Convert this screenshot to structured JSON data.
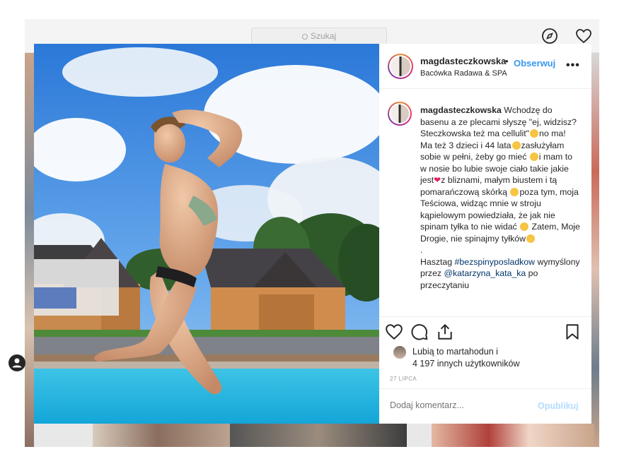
{
  "search": {
    "placeholder": "Szukaj"
  },
  "post": {
    "username": "magdasteczkowska",
    "separator": "•",
    "follow_label": "Obserwuj",
    "location": "Bacówka Radawa & SPA",
    "caption_parts": {
      "p1": "Wchodzę do basenu a ze plecami słyszę \"ej, widzisz? Steczkowska też ma cellulit\"",
      "p2": "no ma! Ma też 3 dzieci i 44 lata",
      "p3": "zasłużyłam sobie w pełni, żeby go mieć",
      "p4": "i mam to w nosie bo lubie swoje ciało takie jakie jest",
      "p5": "z bliznami, małym biustem i tą pomarańczową skórką",
      "p6": "poza tym, moja Teściowa, widząc mnie w stroju kąpielowym powiedziała, że jak nie spinam tyłka to nie widać",
      "p7": "Zatem, Moje Drogie, nie spinajmy tyłków",
      "p8": ".",
      "p9": "Hasztag",
      "hashtag": "#bezspinyposladkow",
      "p10": "wymyślony przez",
      "mention": "@katarzyna_kata_ka",
      "p11": "po przeczytaniu"
    },
    "likes_line1": "Lubią to martahodun i",
    "likes_line2": "4 197 innych użytkowników",
    "date": "27 LIPCA",
    "comment_placeholder": "Dodaj komentarz...",
    "publish_label": "Opublikuj"
  },
  "icons": [
    "search-icon",
    "compass-icon",
    "heart-icon",
    "more-icon",
    "like-icon",
    "comment-icon",
    "share-icon",
    "bookmark-icon",
    "user-tag-icon"
  ],
  "colors": {
    "link": "#3897f0",
    "text": "#262626",
    "muted": "#999999",
    "publish_disabled": "#b3dbff"
  }
}
